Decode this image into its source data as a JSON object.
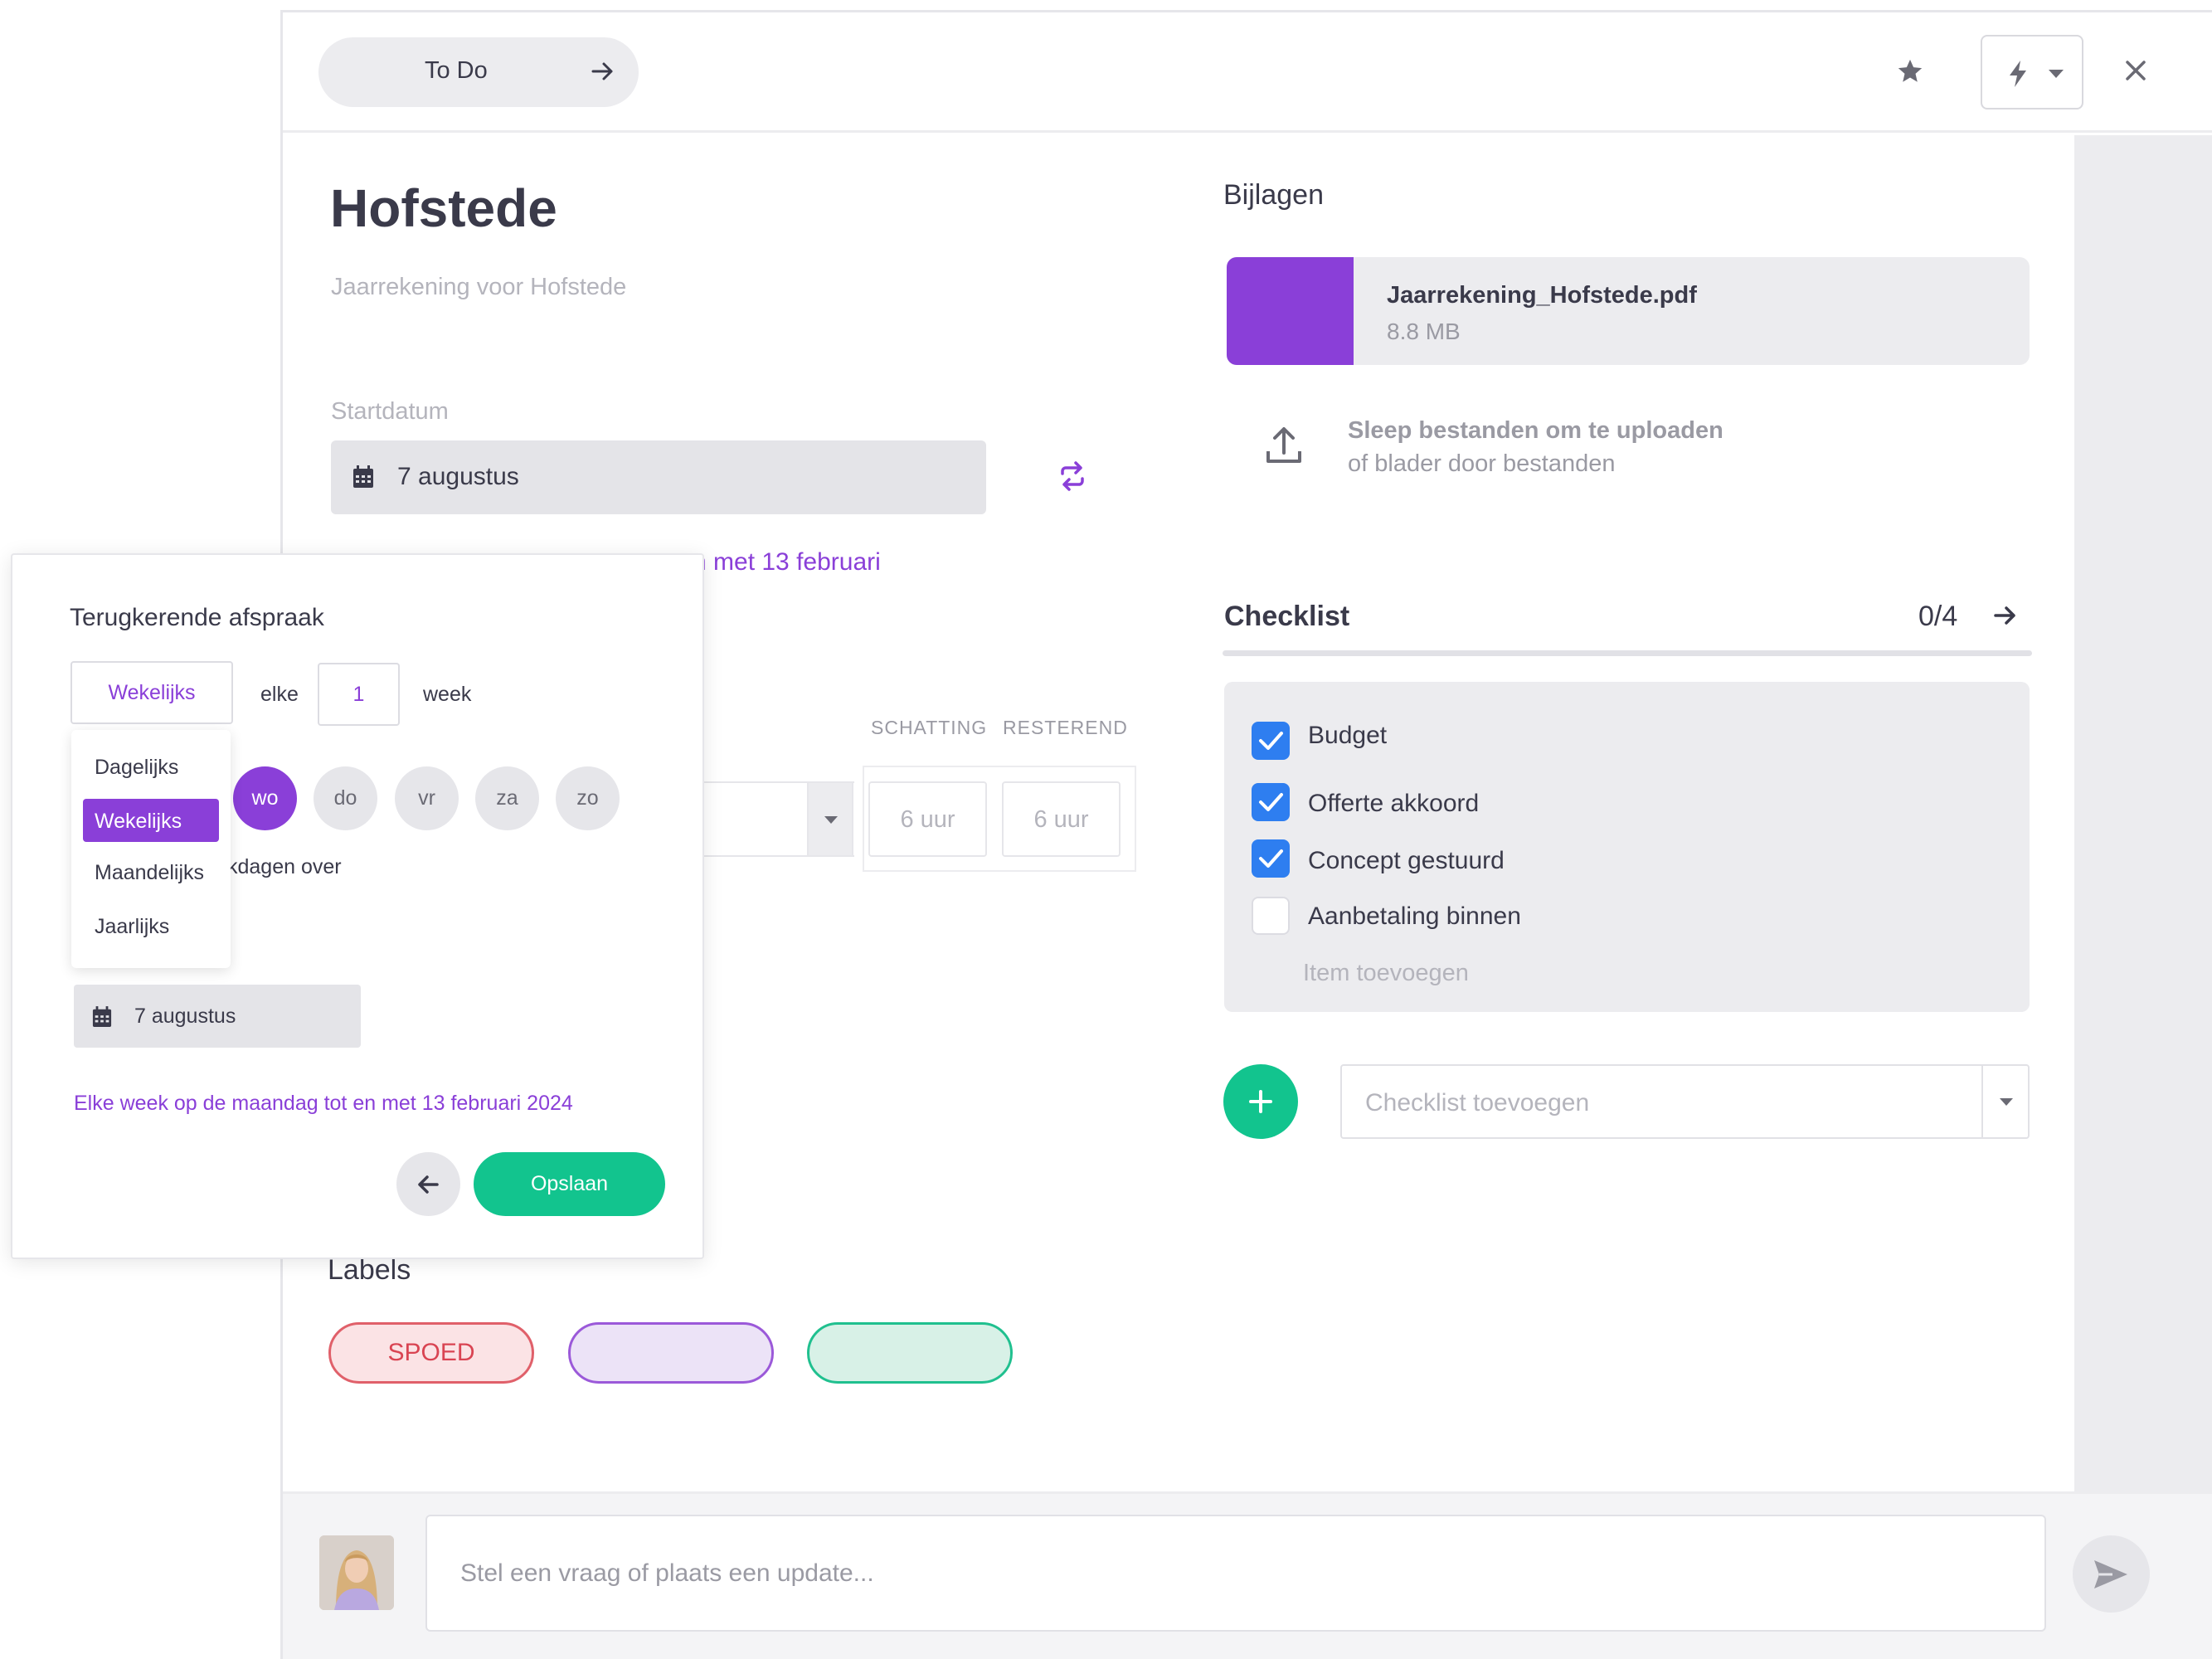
{
  "header": {
    "status_label": "To Do"
  },
  "task": {
    "title": "Hofstede",
    "description": "Jaarrekening voor Hofstede",
    "start_label": "Startdatum",
    "start_date": "7 augustus",
    "recurrence_partial": "n met 13 februari"
  },
  "estimates": {
    "schatting_label": "SCHATTING",
    "resterend_label": "RESTEREND",
    "schatting_value": "6 uur",
    "resterend_value": "6 uur"
  },
  "labels": {
    "heading": "Labels",
    "items": [
      {
        "text": "SPOED",
        "border": "#e0606a",
        "bg": "#fbe3e5",
        "color": "#d94452"
      },
      {
        "text": "",
        "border": "#9b59d9",
        "bg": "#ece3f7",
        "color": "#8a3fd8"
      },
      {
        "text": "",
        "border": "#20c08f",
        "bg": "#d8f1e7",
        "color": "#12a07a"
      }
    ]
  },
  "attachments": {
    "heading": "Bijlagen",
    "file_name": "Jaarrekening_Hofstede.pdf",
    "file_size": "8.8 MB",
    "swatch_color": "#8a3fd8",
    "upload_line1": "Sleep bestanden om te uploaden",
    "upload_line2": "of blader door bestanden"
  },
  "checklist": {
    "heading": "Checklist",
    "count": "0/4",
    "items": [
      {
        "label": "Budget",
        "checked": true
      },
      {
        "label": "Offerte akkoord",
        "checked": true
      },
      {
        "label": "Concept gestuurd",
        "checked": true
      },
      {
        "label": "Aanbetaling binnen",
        "checked": false
      }
    ],
    "add_item": "Item toevoegen",
    "add_checklist_placeholder": "Checklist toevoegen"
  },
  "comment": {
    "placeholder": "Stel een vraag of plaats een update..."
  },
  "popup": {
    "title": "Terugkerende afspraak",
    "frequency": "Wekelijks",
    "every_label": "elke",
    "interval": "1",
    "unit_label": "week",
    "frequency_options": [
      "Dagelijks",
      "Wekelijks",
      "Maandelijks",
      "Jaarlijks"
    ],
    "selected_option": "Wekelijks",
    "days": [
      "wo",
      "do",
      "vr",
      "za",
      "zo"
    ],
    "selected_day": "wo",
    "skip_partial": "kdagen over",
    "end_date": "7 augustus",
    "summary": "Elke week op de maandag tot en met 13 februari 2024",
    "save_label": "Opslaan"
  },
  "colors": {
    "accent_purple": "#8a3fd8",
    "accent_green": "#12c48e",
    "checkbox_blue": "#2e7ef0"
  }
}
